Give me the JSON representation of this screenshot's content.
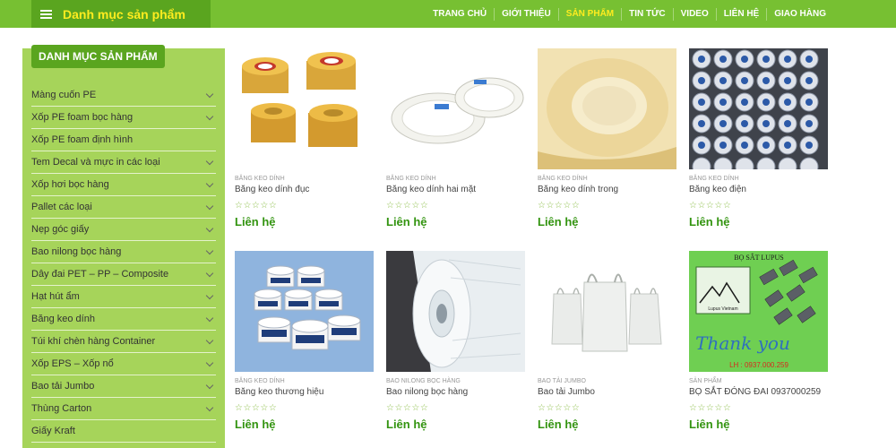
{
  "header": {
    "category_toggle_label": "Danh mục sản phẩm",
    "nav": [
      {
        "label": "TRANG CHỦ",
        "active": false
      },
      {
        "label": "GIỚI THIỆU",
        "active": false
      },
      {
        "label": "SẢN PHẨM",
        "active": true
      },
      {
        "label": "TIN TỨC",
        "active": false
      },
      {
        "label": "VIDEO",
        "active": false
      },
      {
        "label": "LIÊN HỆ",
        "active": false
      },
      {
        "label": "GIAO HÀNG",
        "active": false
      }
    ]
  },
  "sidebar": {
    "title": "DANH MỤC SẢN PHẨM",
    "items": [
      {
        "label": "Màng cuốn PE",
        "has_children": true
      },
      {
        "label": "Xốp PE foam bọc hàng",
        "has_children": true
      },
      {
        "label": "Xốp PE foam định hình",
        "has_children": false
      },
      {
        "label": "Tem Decal và mực in các loại",
        "has_children": true
      },
      {
        "label": "Xốp hơi bọc hàng",
        "has_children": true
      },
      {
        "label": "Pallet các loại",
        "has_children": true
      },
      {
        "label": "Nẹp góc giấy",
        "has_children": true
      },
      {
        "label": "Bao nilong bọc hàng",
        "has_children": true
      },
      {
        "label": "Dây đai PET – PP – Composite",
        "has_children": true
      },
      {
        "label": "Hạt hút ẩm",
        "has_children": true
      },
      {
        "label": "Băng keo dính",
        "has_children": true
      },
      {
        "label": "Túi khí chèn hàng Container",
        "has_children": true
      },
      {
        "label": "Xốp EPS – Xốp nổ",
        "has_children": true
      },
      {
        "label": "Bao tải Jumbo",
        "has_children": true
      },
      {
        "label": "Thùng Carton",
        "has_children": true
      },
      {
        "label": "Giấy Kraft",
        "has_children": false
      }
    ]
  },
  "products": [
    {
      "category": "BĂNG KEO DÍNH",
      "name": "Băng keo dính đục",
      "rating": "☆☆☆☆☆",
      "price": "Liên hệ",
      "image": "tape-rolls-tan"
    },
    {
      "category": "BĂNG KEO DÍNH",
      "name": "Băng keo dính hai mặt",
      "rating": "☆☆☆☆☆",
      "price": "Liên hệ",
      "image": "double-sided-tape"
    },
    {
      "category": "BĂNG KEO DÍNH",
      "name": "Băng keo dính trong",
      "rating": "☆☆☆☆☆",
      "price": "Liên hệ",
      "image": "clear-tape-closeup"
    },
    {
      "category": "BĂNG KEO DÍNH",
      "name": "Băng keo điện",
      "rating": "☆☆☆☆☆",
      "price": "Liên hệ",
      "image": "electrical-tape-stack"
    },
    {
      "category": "BĂNG KEO DÍNH",
      "name": "Băng keo thương hiệu",
      "rating": "☆☆☆☆☆",
      "price": "Liên hệ",
      "image": "branded-tape-uac"
    },
    {
      "category": "BAO NILONG BỌC HÀNG",
      "name": "Bao nilong bọc hàng",
      "rating": "☆☆☆☆☆",
      "price": "Liên hệ",
      "image": "plastic-film-roll"
    },
    {
      "category": "BAO TẢI JUMBO",
      "name": "Bao tải Jumbo",
      "rating": "☆☆☆☆☆",
      "price": "Liên hệ",
      "image": "jumbo-bags"
    },
    {
      "category": "SẢN PHẨM",
      "name": "BỌ SẮT ĐÓNG ĐAI 0937000259",
      "rating": "☆☆☆☆☆",
      "price": "Liên hệ",
      "image": "steel-seals",
      "image_text": {
        "top": "BỌ SẮT LUPUS",
        "brand": "Lupus Vietnam",
        "script": "Thank you",
        "phone": "LH : 0937.000.259"
      }
    }
  ],
  "colors": {
    "header_bg": "#77c032",
    "toggle_bg": "#5aa51f",
    "accent_yellow": "#ffec1f",
    "sidebar_bg": "#a6d45a",
    "price_green": "#339410"
  }
}
